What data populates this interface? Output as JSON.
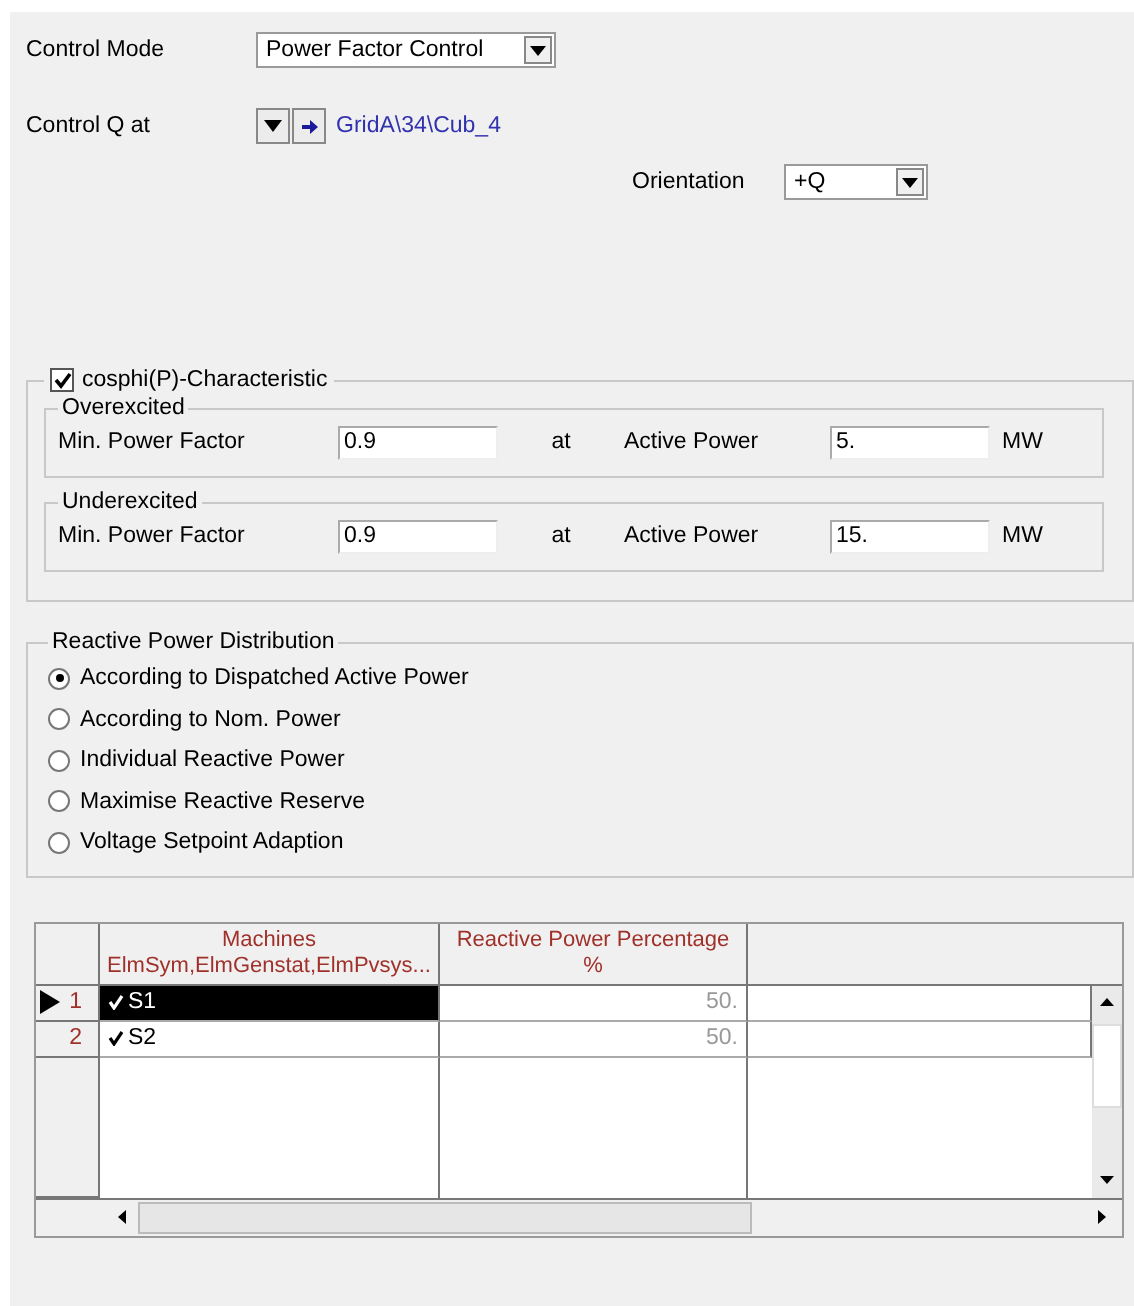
{
  "control_mode": {
    "label": "Control Mode",
    "value": "Power Factor Control"
  },
  "control_q": {
    "label": "Control Q at",
    "link": "GridA\\34\\Cub_4"
  },
  "orientation": {
    "label": "Orientation",
    "value": "+Q"
  },
  "cosphi": {
    "label": "cosphi(P)-Characteristic",
    "checked": true,
    "groups": [
      {
        "title": "Overexcited",
        "factor_label": "Min. Power Factor",
        "factor": "0.9",
        "at": "at",
        "power_label": "Active Power",
        "power": "5.",
        "unit": "MW"
      },
      {
        "title": "Underexcited",
        "factor_label": "Min. Power Factor",
        "factor": "0.9",
        "at": "at",
        "power_label": "Active Power",
        "power": "15.",
        "unit": "MW"
      }
    ]
  },
  "distribution": {
    "title": "Reactive Power Distribution",
    "options": [
      {
        "label": "According to Dispatched Active Power",
        "selected": true
      },
      {
        "label": "According to Nom. Power",
        "selected": false
      },
      {
        "label": "Individual Reactive Power",
        "selected": false
      },
      {
        "label": "Maximise Reactive Reserve",
        "selected": false
      },
      {
        "label": "Voltage Setpoint Adaption",
        "selected": false
      }
    ]
  },
  "table": {
    "columns": [
      {
        "title": "Machines",
        "subtitle": "ElmSym,ElmGenstat,ElmPvsys..."
      },
      {
        "title": "Reactive Power Percentage",
        "subtitle": "%"
      }
    ],
    "rows": [
      {
        "number": "1",
        "machine": "S1",
        "checked": true,
        "percentage": "50.",
        "selected": true
      },
      {
        "number": "2",
        "machine": "S2",
        "checked": true,
        "percentage": "50.",
        "selected": false
      }
    ]
  }
}
